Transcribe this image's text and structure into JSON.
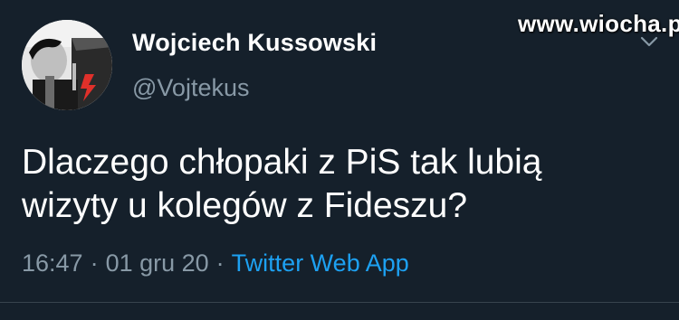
{
  "watermark": "www.wiocha.pl",
  "author": {
    "name": "Wojciech Kussowski",
    "handle": "@Vojtekus"
  },
  "tweet": {
    "text_lines": [
      "Dlaczego chłopaki z PiS tak lubią",
      "wizyty u kolegów z Fideszu?"
    ]
  },
  "meta": {
    "time": "16:47",
    "separator": "·",
    "date": "01 gru 20",
    "source": "Twitter Web App"
  },
  "icons": {
    "caret": "chevron-down-icon"
  },
  "colors": {
    "background": "#15202b",
    "text_primary": "#ffffff",
    "text_secondary": "#8899a6",
    "link": "#1da1f2",
    "divider": "#38444d"
  }
}
